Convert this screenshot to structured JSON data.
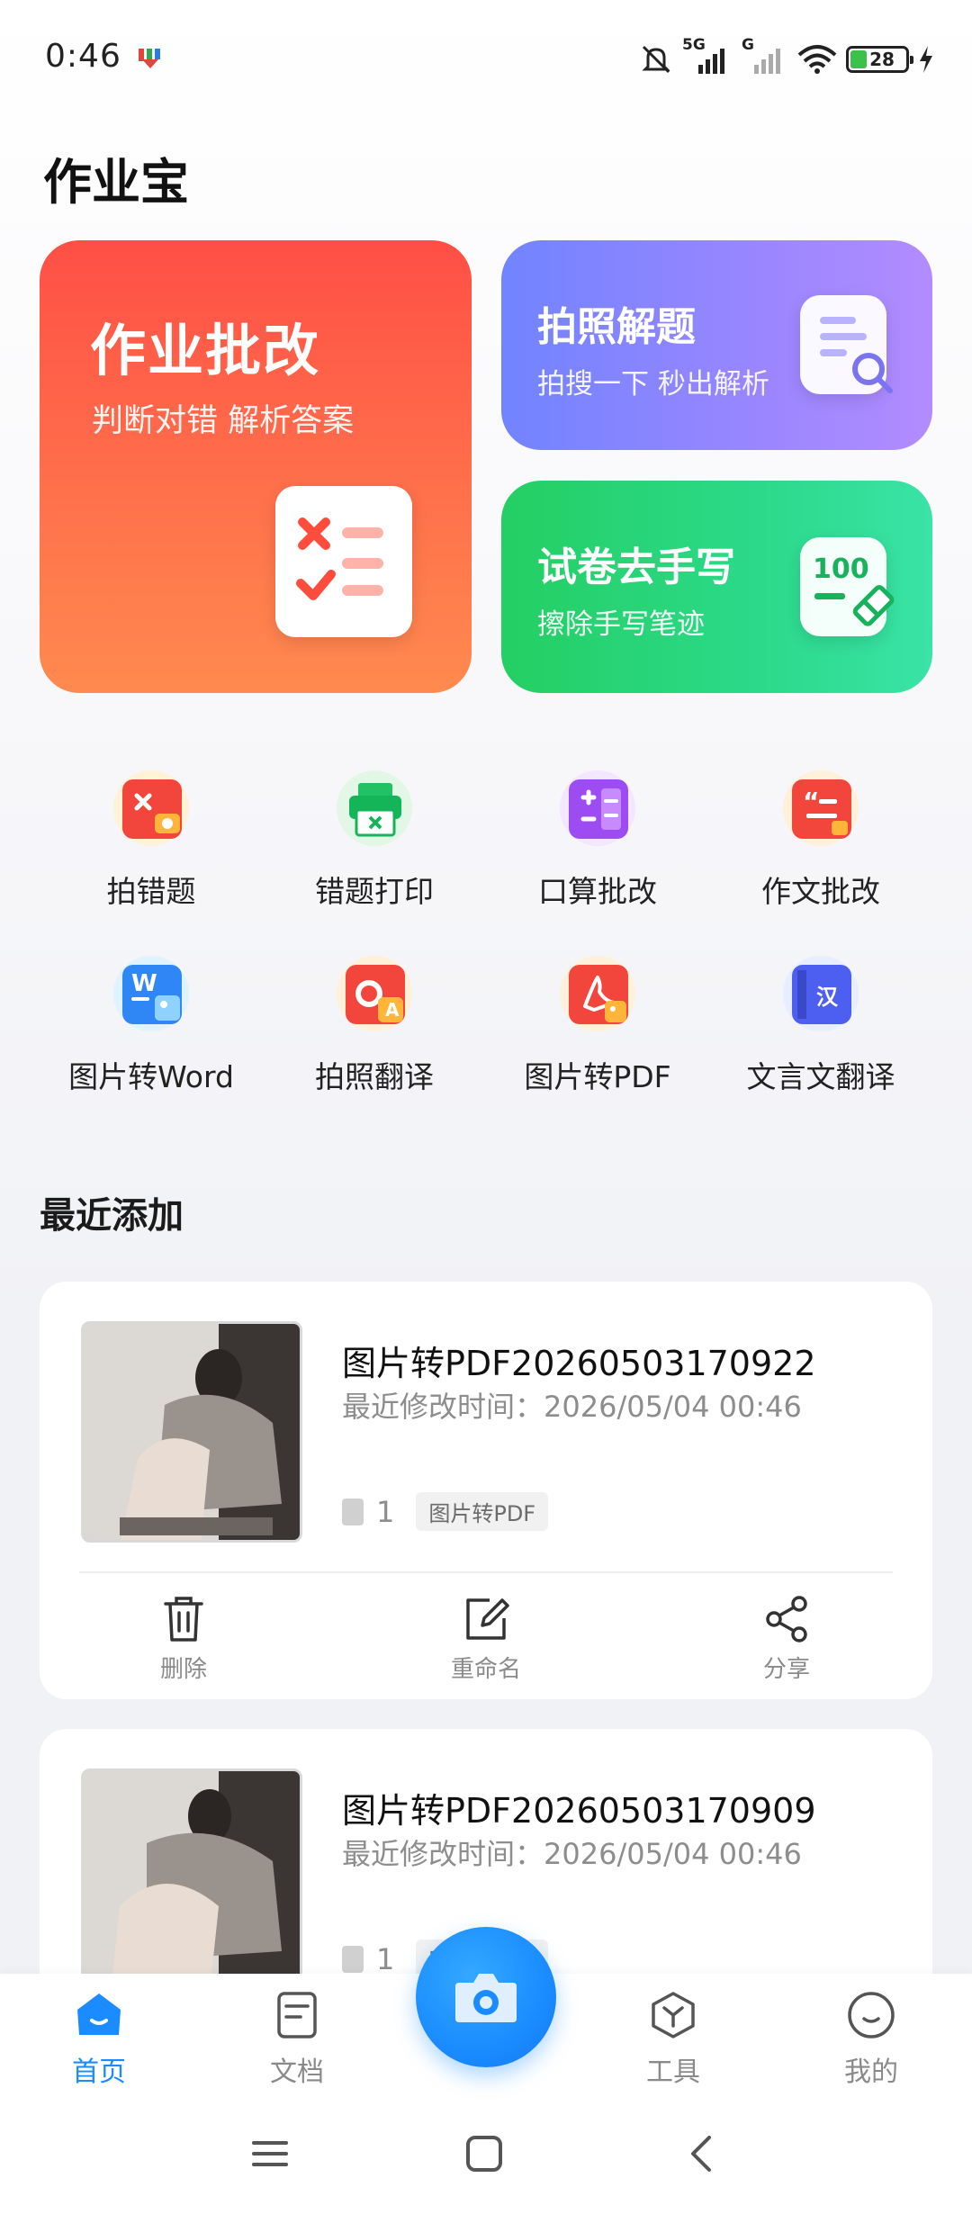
{
  "status_bar": {
    "time": "0:46",
    "signal_label": "5G",
    "signal2_label": "G",
    "battery": "28"
  },
  "app": {
    "title": "作业宝"
  },
  "feature_cards": {
    "homework": {
      "title": "作业批改",
      "subtitle": "判断对错 解析答案"
    },
    "photo_solve": {
      "title": "拍照解题",
      "subtitle": "拍搜一下 秒出解析"
    },
    "erase_handwriting": {
      "title": "试卷去手写",
      "subtitle": "擦除手写笔迹",
      "icon_text": "100"
    }
  },
  "tools": [
    {
      "label": "拍错题",
      "icon": "camera-mistake-icon"
    },
    {
      "label": "错题打印",
      "icon": "printer-icon"
    },
    {
      "label": "口算批改",
      "icon": "calculator-icon"
    },
    {
      "label": "作文批改",
      "icon": "essay-icon"
    },
    {
      "label": "图片转Word",
      "icon": "word-icon",
      "icon_text": "W"
    },
    {
      "label": "拍照翻译",
      "icon": "translate-icon",
      "icon_text": "A"
    },
    {
      "label": "图片转PDF",
      "icon": "pdf-icon"
    },
    {
      "label": "文言文翻译",
      "icon": "classical-chinese-icon",
      "icon_text": "汉"
    }
  ],
  "recent": {
    "title": "最近添加",
    "items": [
      {
        "name": "图片转PDF20260503170922",
        "modified": "最近修改时间：2026/05/04 00:46",
        "pages": "1",
        "tag": "图片转PDF"
      },
      {
        "name": "图片转PDF20260503170909",
        "modified": "最近修改时间：2026/05/04 00:46",
        "pages": "1",
        "tag": "图片转PDF"
      }
    ],
    "actions": {
      "delete": "删除",
      "rename": "重命名",
      "share": "分享"
    }
  },
  "bottom_nav": {
    "home": "首页",
    "docs": "文档",
    "tools": "工具",
    "mine": "我的"
  },
  "colors": {
    "accent": "#1a8cff",
    "homework_card": "#ff5a46",
    "photo_card": "#8a86ff",
    "erase_card": "#2ad47c"
  }
}
